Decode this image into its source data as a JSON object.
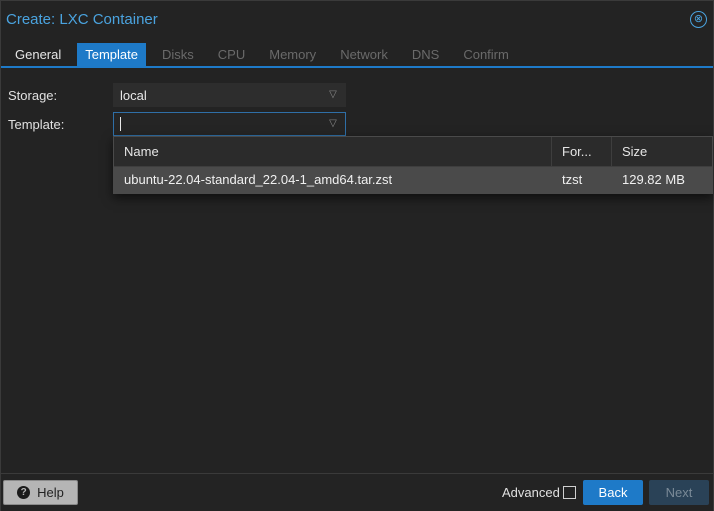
{
  "window": {
    "title": "Create: LXC Container",
    "close_icon": "⊗"
  },
  "tabs": [
    {
      "label": "General",
      "state": "enabled"
    },
    {
      "label": "Template",
      "state": "active"
    },
    {
      "label": "Disks",
      "state": "disabled"
    },
    {
      "label": "CPU",
      "state": "disabled"
    },
    {
      "label": "Memory",
      "state": "disabled"
    },
    {
      "label": "Network",
      "state": "disabled"
    },
    {
      "label": "DNS",
      "state": "disabled"
    },
    {
      "label": "Confirm",
      "state": "disabled"
    }
  ],
  "form": {
    "storage_label": "Storage:",
    "storage_value": "local",
    "template_label": "Template:",
    "template_value": ""
  },
  "template_grid": {
    "columns": [
      "Name",
      "For...",
      "Size"
    ],
    "rows": [
      {
        "name": "ubuntu-22.04-standard_22.04-1_amd64.tar.zst",
        "format": "tzst",
        "size": "129.82 MB"
      }
    ]
  },
  "footer": {
    "help_label": "Help",
    "advanced_label": "Advanced",
    "advanced_checked": false,
    "back_label": "Back",
    "next_label": "Next"
  },
  "colors": {
    "accent": "#1e7ac8",
    "title": "#4aa3df",
    "background": "#232323"
  }
}
